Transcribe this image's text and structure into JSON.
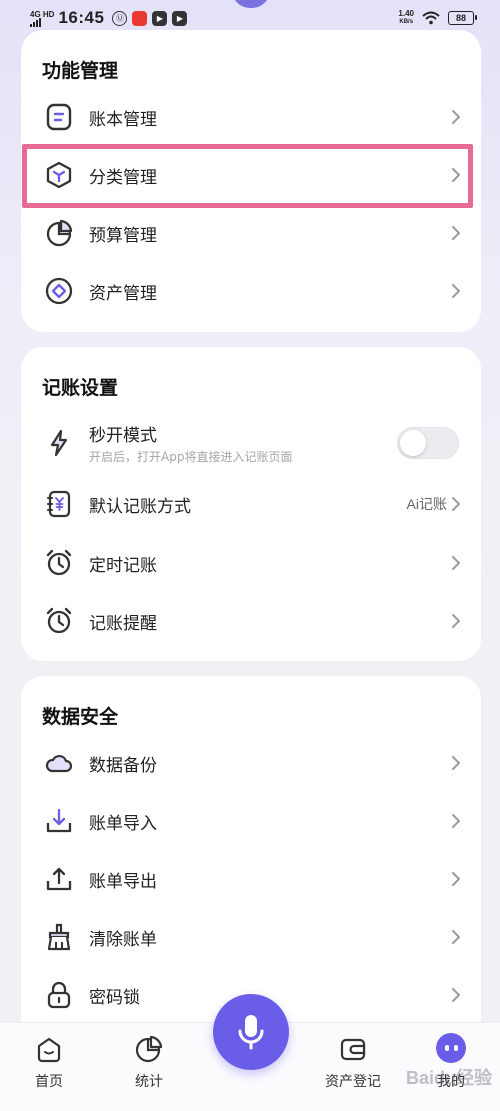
{
  "status_bar": {
    "network": "4G HD",
    "time": "16:45",
    "speed_value": "1.40",
    "speed_unit": "KB/s",
    "battery": "88"
  },
  "sections": {
    "function_mgmt": {
      "title": "功能管理",
      "items": [
        {
          "label": "账本管理",
          "icon": "ledger-icon"
        },
        {
          "label": "分类管理",
          "icon": "category-cube-icon"
        },
        {
          "label": "预算管理",
          "icon": "pie-chart-icon"
        },
        {
          "label": "资产管理",
          "icon": "asset-coin-icon"
        }
      ]
    },
    "bookkeeping_settings": {
      "title": "记账设置",
      "quick_open": {
        "label": "秒开模式",
        "subtitle": "开启后，打开App将直接进入记账页面",
        "enabled": false
      },
      "default_method": {
        "label": "默认记账方式",
        "value": "Ai记账"
      },
      "timed": {
        "label": "定时记账"
      },
      "reminder": {
        "label": "记账提醒"
      }
    },
    "data_security": {
      "title": "数据安全",
      "items": [
        {
          "label": "数据备份",
          "icon": "cloud-icon"
        },
        {
          "label": "账单导入",
          "icon": "download-icon"
        },
        {
          "label": "账单导出",
          "icon": "upload-icon"
        },
        {
          "label": "清除账单",
          "icon": "broom-icon"
        },
        {
          "label": "密码锁",
          "icon": "lock-icon"
        }
      ]
    }
  },
  "bottom_nav": {
    "home": "首页",
    "stats": "统计",
    "assets": "资产登记",
    "me": "我的"
  },
  "watermark": "Baidu经验",
  "colors": {
    "accent": "#6a5ee8",
    "highlight": "#e86b96"
  }
}
